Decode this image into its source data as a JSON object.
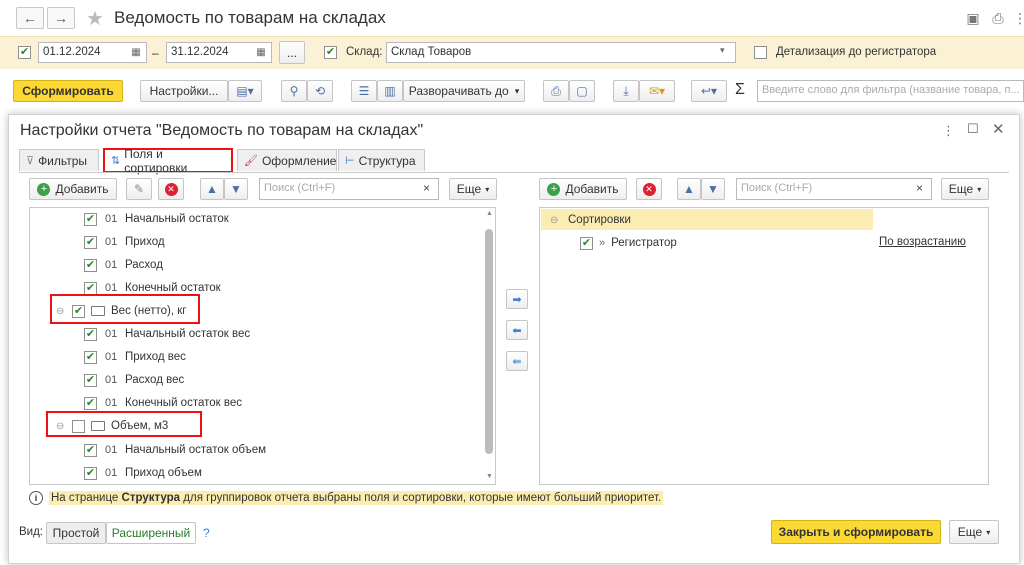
{
  "window": {
    "title": "Ведомость по товарам на складах"
  },
  "params": {
    "date_from": "01.12.2024",
    "date_to": "31.12.2024",
    "dash": "–",
    "dots": "...",
    "warehouse_label": "Склад:",
    "warehouse_value": "Склад Товаров",
    "detail_label": "Детализация до регистратора"
  },
  "toolbar": {
    "generate": "Сформировать",
    "settings": "Настройки...",
    "expand": "Разворачивать до",
    "sigma": "Σ",
    "filter_placeholder": "Введите слово для фильтра (название товара, п..."
  },
  "dialog": {
    "title": "Настройки отчета \"Ведомость по товарам на складах\"",
    "tabs": [
      {
        "label": "Фильтры"
      },
      {
        "label": "Поля и сортировки"
      },
      {
        "label": "Оформление"
      },
      {
        "label": "Структура"
      }
    ],
    "left": {
      "add": "Добавить",
      "search_placeholder": "Поиск (Ctrl+F)",
      "more": "Еще",
      "items": [
        {
          "code": "01",
          "label": "Начальный остаток",
          "checked": true
        },
        {
          "code": "01",
          "label": "Приход",
          "checked": true
        },
        {
          "code": "01",
          "label": "Расход",
          "checked": true
        },
        {
          "code": "01",
          "label": "Конечный остаток",
          "checked": true
        },
        {
          "group": true,
          "label": "Вес (нетто), кг",
          "checked": true
        },
        {
          "code": "01",
          "label": "Начальный остаток вес",
          "checked": true
        },
        {
          "code": "01",
          "label": "Приход вес",
          "checked": true
        },
        {
          "code": "01",
          "label": "Расход вес",
          "checked": true
        },
        {
          "code": "01",
          "label": "Конечный остаток вес",
          "checked": true
        },
        {
          "group": true,
          "label": "Объем, м3",
          "checked": false
        },
        {
          "code": "01",
          "label": "Начальный остаток объем",
          "checked": true
        },
        {
          "code": "01",
          "label": "Приход объем",
          "checked": true
        }
      ]
    },
    "right": {
      "add": "Добавить",
      "search_placeholder": "Поиск (Ctrl+F)",
      "more": "Еще",
      "group_label": "Сортировки",
      "row_label": "Регистратор",
      "row_order": "По возрастанию"
    },
    "info": {
      "prefix": "На странице ",
      "bold": "Структура",
      "suffix": " для группировок отчета выбраны поля и сортировки, которые имеют больший приоритет."
    },
    "footer": {
      "view_label": "Вид:",
      "simple": "Простой",
      "extended": "Расширенный",
      "help": "?",
      "close_generate": "Закрыть и сформировать",
      "more": "Еще"
    }
  },
  "colors": {
    "accent_yellow": "#fcd833",
    "check_green": "#2a8a2a",
    "highlight": "#fbedb2",
    "marker_red": "#e11111"
  }
}
